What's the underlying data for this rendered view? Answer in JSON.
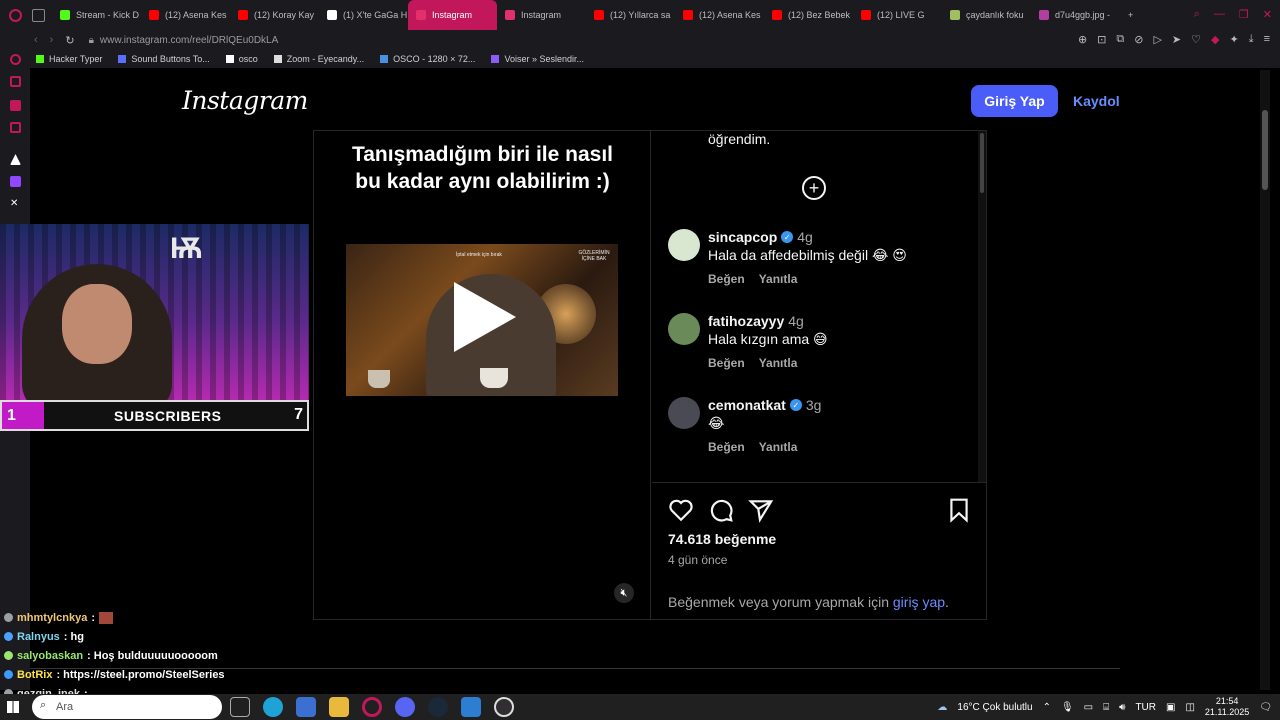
{
  "browser": {
    "tabs": [
      {
        "label": "Stream - Kick D",
        "color": "#53fc18",
        "active": false
      },
      {
        "label": "(12) Asena Kes",
        "color": "#ff0000",
        "active": false
      },
      {
        "label": "(12) Koray Kay",
        "color": "#ff0000",
        "active": false
      },
      {
        "label": "(1) X'te GaGa H",
        "color": "#ffffff",
        "active": false
      },
      {
        "label": "Instagram",
        "color": "#e1306c",
        "active": true
      },
      {
        "label": "Instagram",
        "color": "#e1306c",
        "active": false
      },
      {
        "label": "(12) Yıllarca sa",
        "color": "#ff0000",
        "active": false
      },
      {
        "label": "(12) Asena Kes",
        "color": "#ff0000",
        "active": false
      },
      {
        "label": "(12) Bez Bebek",
        "color": "#ff0000",
        "active": false
      },
      {
        "label": "(12) LIVE G",
        "color": "#ff0000",
        "active": false
      },
      {
        "label": "çaydanlık foku",
        "color": "#a0c060",
        "active": false
      },
      {
        "label": "d7u4ggb.jpg -",
        "color": "#b03fa0",
        "active": false
      }
    ],
    "url": "www.instagram.com/reel/DRlQEu0DkLA",
    "bookmarks": [
      "Hacker Typer",
      "Sound Buttons To...",
      "osco",
      "Zoom - Eyecandy...",
      "OSCO - 1280 × 72...",
      "Voiser » Seslendir..."
    ]
  },
  "instagram": {
    "logo": "Instagram",
    "login_label": "Giriş Yap",
    "signup_label": "Kaydol",
    "caption": "Tanışmadığım biri ile nasıl bu kadar aynı olabilirim :)",
    "video_overlay_top": "İptal etmek için bırak",
    "video_overlay_corner": "GÖZLERİMİN İÇİNE BAK",
    "previous_comment_tail": "öğrendim.",
    "comments": [
      {
        "user": "sincapcop",
        "verified": true,
        "time": "4g",
        "text": "Hala da affedebilmiş değil 😂 😍",
        "like": "Beğen",
        "reply": "Yanıtla",
        "avatar_color": "#d9e6d0"
      },
      {
        "user": "fatihozayyy",
        "verified": false,
        "time": "4g",
        "text": "Hala kızgın ama 😅",
        "like": "Beğen",
        "reply": "Yanıtla",
        "avatar_color": "#6a8a5a"
      },
      {
        "user": "cemonatkat",
        "verified": true,
        "time": "3g",
        "text": "😂",
        "like": "Beğen",
        "reply": "Yanıtla",
        "avatar_color": "#4a4a55"
      }
    ],
    "likes": "74.618 beğenme",
    "posted": "4 gün önce",
    "login_prompt": "Beğenmek veya yorum yapmak için",
    "login_prompt_link": "giriş yap",
    "login_prompt_end": "."
  },
  "stream": {
    "sub_count_left": "1",
    "sub_label": "SUBSCRIBERS",
    "sub_count_right": "7",
    "chat": [
      {
        "user": "mhmtylcnkya",
        "msg": ":",
        "user_color": "#f0c674",
        "emote": true
      },
      {
        "user": "Ralnyus",
        "msg": ": hg",
        "user_color": "#7fd4f0",
        "emote": false
      },
      {
        "user": "salyobaskan",
        "msg": ": Hoş bulduuuuuooooom",
        "user_color": "#9ae66e",
        "emote": false
      },
      {
        "user": "BotRix",
        "msg": ": https://steel.promo/SteelSeries",
        "user_color": "#ffe04a",
        "emote": false
      },
      {
        "user": "gezgin_inek",
        "msg": ":",
        "user_color": "#e0e0e0",
        "emote": false
      }
    ]
  },
  "taskbar": {
    "search_text": "Ara",
    "weather": "16°C  Çok bulutlu",
    "lang": "TUR",
    "time": "21:54",
    "date": "21.11.2025"
  }
}
